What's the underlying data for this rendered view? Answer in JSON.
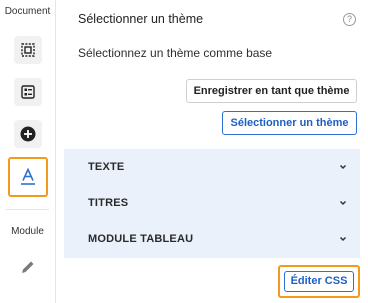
{
  "rail": {
    "document_label": "Document",
    "module_label": "Module",
    "icons": [
      "select-frame-icon",
      "layout-list-icon",
      "add-circle-icon",
      "text-style-icon",
      "pencil-icon"
    ],
    "accent_color": "#f39a1e"
  },
  "panel": {
    "title": "Sélectionner un thème",
    "help_label": "?",
    "subtitle": "Sélectionnez un thème comme base",
    "save_as_theme_label": "Enregistrer en tant que thème",
    "select_theme_label": "Sélectionner un thème",
    "sections": [
      {
        "label": "TEXTE"
      },
      {
        "label": "TITRES"
      },
      {
        "label": "MODULE TABLEAU"
      }
    ],
    "edit_css_label": "Éditer CSS",
    "link_color": "#1f5fc4",
    "accordion_bg": "#ebf1fb"
  }
}
